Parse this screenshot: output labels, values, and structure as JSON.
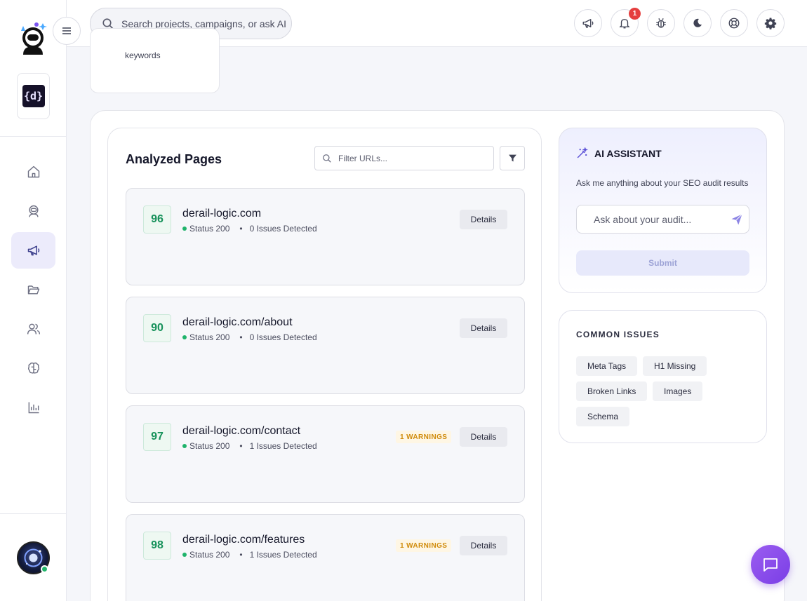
{
  "topbar": {
    "search_placeholder": "Search projects, campaigns, or ask AI",
    "notifications_count": "1",
    "icons": [
      "megaphone-icon",
      "bell-icon",
      "bug-icon",
      "moon-icon",
      "lifebuoy-icon",
      "gear-icon"
    ]
  },
  "sidebar": {
    "project_logo_text": "{d}",
    "nav": [
      "home-icon",
      "astronaut-icon",
      "megaphone-icon",
      "folder-icon",
      "users-icon",
      "brain-icon",
      "bar-chart-icon"
    ],
    "active_nav": "megaphone-icon"
  },
  "keywords_card": {
    "label": "keywords"
  },
  "analyzed_pages": {
    "title": "Analyzed Pages",
    "filter_placeholder": "Filter URLs...",
    "details_label": "Details",
    "pages": [
      {
        "score": "96",
        "url": "derail-logic.com",
        "status": "Status 200",
        "issues": "0 Issues Detected",
        "warning": ""
      },
      {
        "score": "90",
        "url": "derail-logic.com/about",
        "status": "Status 200",
        "issues": "0 Issues Detected",
        "warning": ""
      },
      {
        "score": "97",
        "url": "derail-logic.com/contact",
        "status": "Status 200",
        "issues": "1 Issues Detected",
        "warning": "1 WARNINGS"
      },
      {
        "score": "98",
        "url": "derail-logic.com/features",
        "status": "Status 200",
        "issues": "1 Issues Detected",
        "warning": "1 WARNINGS"
      }
    ]
  },
  "ai_assistant": {
    "title": "AI ASSISTANT",
    "subtitle": "Ask me anything about your SEO audit results",
    "input_placeholder": "Ask about your audit...",
    "submit_label": "Submit"
  },
  "common_issues": {
    "title": "COMMON ISSUES",
    "tags": [
      "Meta Tags",
      "H1 Missing",
      "Broken Links",
      "Images",
      "Schema"
    ]
  },
  "colors": {
    "accent": "#7a3ee6",
    "score_green": "#16915a",
    "warning": "#d08b0b",
    "notification": "#e53e3e"
  }
}
